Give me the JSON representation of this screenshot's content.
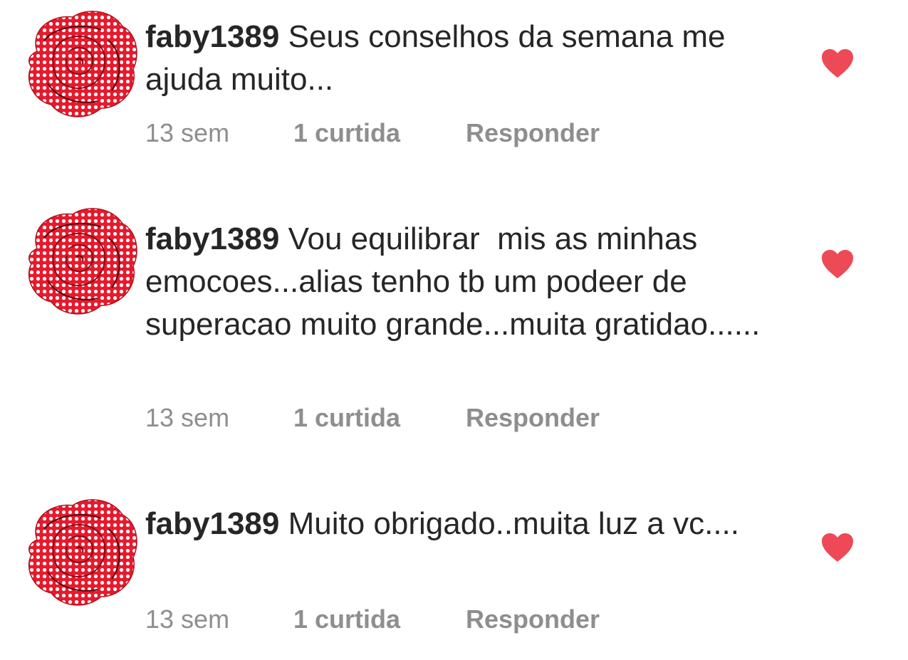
{
  "colors": {
    "heart": "#ed4956",
    "text": "#262626",
    "meta": "#8e8e8e",
    "avatar_red": "#e8192c"
  },
  "comments": [
    {
      "avatar_icon": "rose-avatar",
      "username": "faby1389",
      "text": "Seus conselhos da semana me ajuda muito...",
      "time": "13 sem",
      "likes": "1 curtida",
      "reply_label": "Responder",
      "liked": true
    },
    {
      "avatar_icon": "rose-avatar",
      "username": "faby1389",
      "text": "Vou equilibrar  mis as minhas emocoes...alias tenho tb um podeer de superacao muito grande...muita gratidao......",
      "time": "13 sem",
      "likes": "1 curtida",
      "reply_label": "Responder",
      "liked": true
    },
    {
      "avatar_icon": "rose-avatar",
      "username": "faby1389",
      "text": "Muito obrigado..muita luz a vc....",
      "time": "13 sem",
      "likes": "1 curtida",
      "reply_label": "Responder",
      "liked": true
    }
  ]
}
